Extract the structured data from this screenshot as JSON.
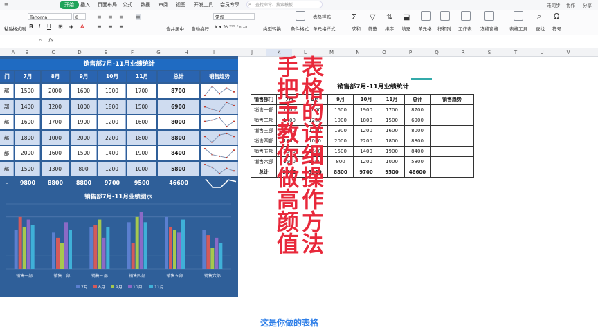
{
  "menu": {
    "items": [
      "开始",
      "插入",
      "页面布局",
      "公式",
      "数据",
      "审阅",
      "视图",
      "开发工具",
      "会员专享"
    ],
    "search_placeholder": "查找命令、搜索模板",
    "right_items": [
      "未同步",
      "协作",
      "分享"
    ]
  },
  "ribbon": {
    "paste": "粘贴",
    "format_painter": "格式刷",
    "font_name": "Tahoma",
    "font_size": "8",
    "merge": "合并居中",
    "wrap": "自动换行",
    "number_format": "常规",
    "conditional": "条件格式",
    "table_style": "表格样式",
    "cell_style": "单元格样式",
    "type_convert": "类型转换",
    "sum": "求和",
    "filter": "筛选",
    "sort": "排序",
    "fill": "填充",
    "cell": "单元格",
    "rowcol": "行和列",
    "sheet": "工作表",
    "freeze": "冻结窗格",
    "table_tools": "表格工具",
    "find": "查找",
    "symbol": "符号"
  },
  "formula_bar": {
    "fx": "fx",
    "value": ""
  },
  "columns": [
    "A",
    "B",
    "C",
    "D",
    "E",
    "F",
    "G",
    "H",
    "I",
    "J",
    "K",
    "L",
    "M",
    "N",
    "O",
    "P",
    "Q",
    "R",
    "S",
    "T",
    "U",
    "V"
  ],
  "left_table": {
    "title": "销售部7月-11月业绩统计",
    "headers": [
      "门",
      "7月",
      "8月",
      "9月",
      "10月",
      "11月",
      "总计",
      "销售趋势"
    ],
    "rows": [
      {
        "dept": "部",
        "values": [
          "1500",
          "2000",
          "1600",
          "1900",
          "1700"
        ],
        "total": "8700"
      },
      {
        "dept": "部",
        "values": [
          "1400",
          "1200",
          "1000",
          "1800",
          "1500"
        ],
        "total": "6900"
      },
      {
        "dept": "部",
        "values": [
          "1600",
          "1700",
          "1900",
          "1200",
          "1600"
        ],
        "total": "8000"
      },
      {
        "dept": "部",
        "values": [
          "1800",
          "1000",
          "2000",
          "2200",
          "1800"
        ],
        "total": "8800"
      },
      {
        "dept": "部",
        "values": [
          "2000",
          "1600",
          "1500",
          "1400",
          "1900"
        ],
        "total": "8400"
      },
      {
        "dept": "部",
        "values": [
          "1500",
          "1300",
          "800",
          "1200",
          "1000"
        ],
        "total": "5800"
      }
    ],
    "totals": {
      "label": "-",
      "values": [
        "9800",
        "8800",
        "8800",
        "9700",
        "9500",
        "46600"
      ]
    }
  },
  "chart_data": {
    "type": "bar",
    "title": "销售部7月-11月业绩图示",
    "categories": [
      "销售一部",
      "销售二部",
      "销售三部",
      "销售四部",
      "销售五部",
      "销售六部"
    ],
    "series": [
      {
        "name": "7月",
        "values": [
          1500,
          1400,
          1600,
          1800,
          2000,
          1500
        ],
        "color": "#5b7fcf"
      },
      {
        "name": "8月",
        "values": [
          2000,
          1200,
          1700,
          1000,
          1600,
          1300
        ],
        "color": "#d45a5a"
      },
      {
        "name": "9月",
        "values": [
          1600,
          1000,
          1900,
          2000,
          1500,
          800
        ],
        "color": "#a6c84f"
      },
      {
        "name": "10月",
        "values": [
          1900,
          1800,
          1200,
          2200,
          1400,
          1200
        ],
        "color": "#8b6ac6"
      },
      {
        "name": "11月",
        "values": [
          1700,
          1500,
          1600,
          1800,
          1900,
          1000
        ],
        "color": "#3fb0d8"
      }
    ],
    "ylim": [
      0,
      2500
    ],
    "grid": true,
    "legend": "bottom"
  },
  "right_sheet": {
    "title": "销售部7月-11月业绩统计",
    "headers": [
      "销售部门",
      "7月",
      "8月",
      "9月",
      "10月",
      "11月",
      "总计",
      "销售趋势"
    ],
    "rows": [
      [
        "销售一部",
        "1500",
        "2000",
        "1600",
        "1900",
        "1700",
        "8700"
      ],
      [
        "销售二部",
        "1400",
        "1200",
        "1000",
        "1800",
        "1500",
        "6900"
      ],
      [
        "销售三部",
        "1600",
        "1700",
        "1900",
        "1200",
        "1600",
        "8000"
      ],
      [
        "销售四部",
        "1800",
        "1000",
        "2000",
        "2200",
        "1800",
        "8800"
      ],
      [
        "销售五部",
        "2000",
        "1600",
        "1500",
        "1400",
        "1900",
        "8400"
      ],
      [
        "销售六部",
        "1500",
        "1300",
        "800",
        "1200",
        "1000",
        "5800"
      ]
    ],
    "total_row": [
      "总计",
      "9800",
      "8800",
      "8800",
      "9700",
      "9500",
      "46600"
    ]
  },
  "overlay": {
    "line1": "手把手教你做高颜值",
    "line2": "表格的详细操作方法"
  },
  "subtitle": "这是你做的表格"
}
